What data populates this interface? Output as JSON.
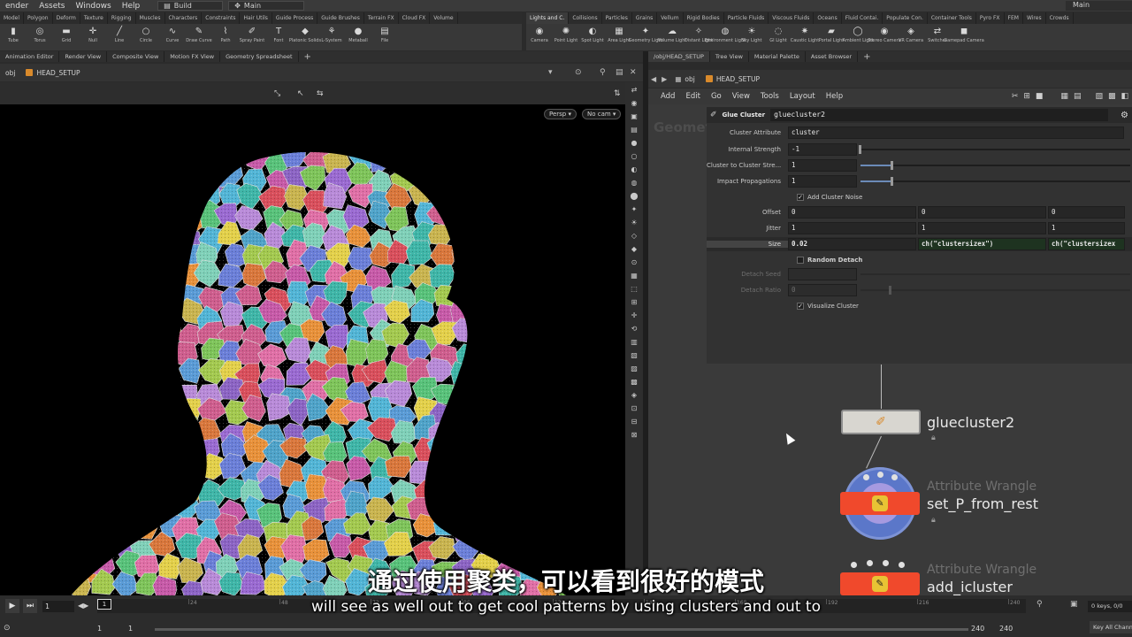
{
  "menubar": {
    "items": [
      "ender",
      "Assets",
      "Windows",
      "Help"
    ],
    "desktop": "Build",
    "scene": "Main",
    "right_label": "Main"
  },
  "shelf_tabs_left": [
    "Model",
    "Polygon",
    "Deform",
    "Texture",
    "Rigging",
    "Muscles",
    "Characters",
    "Constraints",
    "Hair Utils",
    "Guide Process",
    "Guide Brushes",
    "Terrain FX",
    "Cloud FX",
    "Volume"
  ],
  "shelf_tabs_right": [
    "Lights and C.",
    "Collisions",
    "Particles",
    "Grains",
    "Vellum",
    "Rigid Bodies",
    "Particle Fluids",
    "Viscous Fluids",
    "Oceans",
    "Fluid Contai.",
    "Populate Con.",
    "Container Tools",
    "Pyro FX",
    "FEM",
    "Wires",
    "Crowds"
  ],
  "shelf_tools_left": [
    {
      "icon": "tube-icon",
      "glyph": "▮",
      "label": "Tube"
    },
    {
      "icon": "torus-icon",
      "glyph": "◎",
      "label": "Torus"
    },
    {
      "icon": "grid-icon",
      "glyph": "▬",
      "label": "Grid"
    },
    {
      "icon": "null-icon",
      "glyph": "✛",
      "label": "Null"
    },
    {
      "icon": "line-icon",
      "glyph": "╱",
      "label": "Line"
    },
    {
      "icon": "circle-icon",
      "glyph": "○",
      "label": "Circle"
    },
    {
      "icon": "curve-icon",
      "glyph": "∿",
      "label": "Curve"
    },
    {
      "icon": "draw-curve-icon",
      "glyph": "✎",
      "label": "Draw Curve"
    },
    {
      "icon": "path-icon",
      "glyph": "⌇",
      "label": "Path"
    },
    {
      "icon": "spray-paint-icon",
      "glyph": "✐",
      "label": "Spray Paint"
    },
    {
      "icon": "font-icon",
      "glyph": "T",
      "label": "Font"
    },
    {
      "icon": "platonic-solids-icon",
      "glyph": "◆",
      "label": "Platonic Solids"
    },
    {
      "icon": "lsystem-icon",
      "glyph": "⚘",
      "label": "L-System"
    },
    {
      "icon": "metaball-icon",
      "glyph": "●",
      "label": "Metaball"
    },
    {
      "icon": "file-icon",
      "glyph": "▤",
      "label": "File"
    }
  ],
  "shelf_tools_right": [
    {
      "icon": "camera-icon",
      "glyph": "◉",
      "label": "Camera"
    },
    {
      "icon": "point-light-icon",
      "glyph": "✺",
      "label": "Point Light"
    },
    {
      "icon": "spot-light-icon",
      "glyph": "◐",
      "label": "Spot Light"
    },
    {
      "icon": "area-light-icon",
      "glyph": "▦",
      "label": "Area Light"
    },
    {
      "icon": "geometry-light-icon",
      "glyph": "✦",
      "label": "Geometry Light"
    },
    {
      "icon": "volume-light-icon",
      "glyph": "☁",
      "label": "Volume Light"
    },
    {
      "icon": "distant-light-icon",
      "glyph": "✧",
      "label": "Distant Light"
    },
    {
      "icon": "environment-light-icon",
      "glyph": "◍",
      "label": "Environment Light"
    },
    {
      "icon": "sky-light-icon",
      "glyph": "☀",
      "label": "Sky Light"
    },
    {
      "icon": "gi-light-icon",
      "glyph": "◌",
      "label": "GI Light"
    },
    {
      "icon": "caustic-light-icon",
      "glyph": "✷",
      "label": "Caustic Light"
    },
    {
      "icon": "portal-light-icon",
      "glyph": "▰",
      "label": "Portal Light"
    },
    {
      "icon": "ambient-light-icon",
      "glyph": "◯",
      "label": "Ambient Light"
    },
    {
      "icon": "stereo-camera-icon",
      "glyph": "◉",
      "label": "Stereo Camera"
    },
    {
      "icon": "vr-camera-icon",
      "glyph": "◈",
      "label": "VR Camera"
    },
    {
      "icon": "switcher-icon",
      "glyph": "⇄",
      "label": "Switcher"
    },
    {
      "icon": "gamepad-camera-icon",
      "glyph": "◼",
      "label": "Gamepad Camera"
    }
  ],
  "pane_tabs_left": [
    "Animation Editor",
    "Render View",
    "Composite View",
    "Motion FX View",
    "Geometry Spreadsheet"
  ],
  "pane_tabs_right": [
    "/obj/HEAD_SETUP",
    "Tree View",
    "Material Palette",
    "Asset Browser"
  ],
  "viewport_path": {
    "root": "obj",
    "node": "HEAD_SETUP"
  },
  "network_path": {
    "root": "obj",
    "node": "HEAD_SETUP"
  },
  "viewport": {
    "persp": "Persp ▾",
    "camera": "No cam ▾"
  },
  "network_menu": [
    "Add",
    "Edit",
    "Go",
    "View",
    "Tools",
    "Layout",
    "Help"
  ],
  "network_watermark": "Geometry",
  "params": {
    "optype": "Glue Cluster",
    "node_name": "gluecluster2",
    "cluster_attribute_label": "Cluster Attribute",
    "cluster_attribute_value": "cluster",
    "internal_strength_label": "Internal Strength",
    "internal_strength_value": "-1",
    "c2c_label": "Cluster to Cluster Stre...",
    "c2c_value": "1",
    "impact_label": "Impact Propagations",
    "impact_value": "1",
    "add_noise_label": "Add Cluster Noise",
    "offset_label": "Offset",
    "offset_values": [
      "0",
      "0",
      "0"
    ],
    "jitter_label": "Jitter",
    "jitter_values": [
      "1",
      "1",
      "1"
    ],
    "size_label": "Size",
    "size_values": [
      "0.02",
      "ch(\"clustersizex\")",
      "ch(\"clustersizex"
    ],
    "random_detach_label": "Random Detach",
    "detach_seed_label": "Detach Seed",
    "detach_seed_value": "",
    "detach_ratio_label": "Detach Ratio",
    "detach_ratio_value": "0",
    "visualize_label": "Visualize Cluster"
  },
  "nodes": {
    "gluecluster": "gluecluster2",
    "wrangle1_type": "Attribute Wrangle",
    "wrangle1_name": "set_P_from_rest",
    "wrangle2_type": "Attribute Wrangle",
    "wrangle2_name": "add_icluster"
  },
  "timeline": {
    "frame": "1",
    "ticks": [
      "24",
      "48",
      "72",
      "96",
      "120",
      "144",
      "168",
      "192",
      "216",
      "240"
    ],
    "cursor": "1",
    "start": "1",
    "start2": "1",
    "end": "240",
    "end2": "240",
    "keys": "0 keys, 0/0",
    "key_all": "Key All Channels"
  },
  "subtitles": {
    "cn": "通过使用聚类，可以看到很好的模式",
    "en": "will see as well out to get cool patterns by using clusters and out to"
  }
}
